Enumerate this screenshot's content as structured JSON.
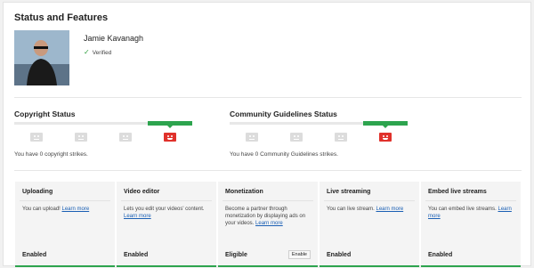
{
  "header": {
    "title": "Status and Features"
  },
  "profile": {
    "name": "Jamie Kavanagh",
    "verified_label": "Verified"
  },
  "copyright": {
    "title": "Copyright Status",
    "message": "You have 0 copyright strikes."
  },
  "community": {
    "title": "Community Guidelines Status",
    "message": "You have 0 Community Guidelines strikes."
  },
  "features": [
    {
      "title": "Uploading",
      "desc": "You can upload!",
      "link": "Learn more",
      "status": "Enabled"
    },
    {
      "title": "Video editor",
      "desc": "Lets you edit your videos' content.",
      "link": "Learn more",
      "status": "Enabled"
    },
    {
      "title": "Monetization",
      "desc": "Become a partner through monetization by displaying ads on your videos.",
      "link": "Learn more",
      "status": "Eligible",
      "button": "Enable"
    },
    {
      "title": "Live streaming",
      "desc": "You can live stream.",
      "link": "Learn more",
      "status": "Enabled"
    },
    {
      "title": "Embed live streams",
      "desc": "You can embed live streams.",
      "link": "Learn more",
      "status": "Enabled"
    }
  ],
  "colors": {
    "accent_green": "#2da44e",
    "active_face": "#e0312b",
    "link": "#1a5fb4"
  },
  "icons": {
    "verified": "check-icon",
    "strike_level": "face-icon"
  }
}
